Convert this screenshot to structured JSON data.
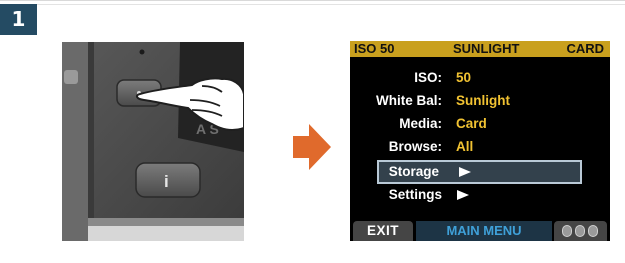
{
  "step": {
    "number": "1"
  },
  "camera_photo": {
    "description_icon": "camera-body-with-menu-button-and-pointing-hand"
  },
  "arrow": {
    "icon": "right-arrow-icon",
    "color": "#e06a2c"
  },
  "lcd": {
    "status_bar": {
      "iso": "ISO 50",
      "white_balance": "SUNLIGHT",
      "storage": "CARD"
    },
    "menu": [
      {
        "label": "ISO",
        "value": "50"
      },
      {
        "label": "White Bal",
        "value": "Sunlight"
      },
      {
        "label": "Media",
        "value": "Card"
      },
      {
        "label": "Browse",
        "value": "All"
      },
      {
        "label": "Storage",
        "value": "",
        "submenu": true,
        "selected": true
      },
      {
        "label": "Settings",
        "value": "",
        "submenu": true
      }
    ],
    "bottom_bar": {
      "exit_label": "EXIT",
      "title": "MAIN MENU",
      "wheel_icon": "scroll-wheel-icon"
    }
  },
  "colors": {
    "badge": "#244b63",
    "status_bar": "#c9a01e",
    "value_text": "#f1c232",
    "main_menu_text": "#3fa0d8"
  }
}
